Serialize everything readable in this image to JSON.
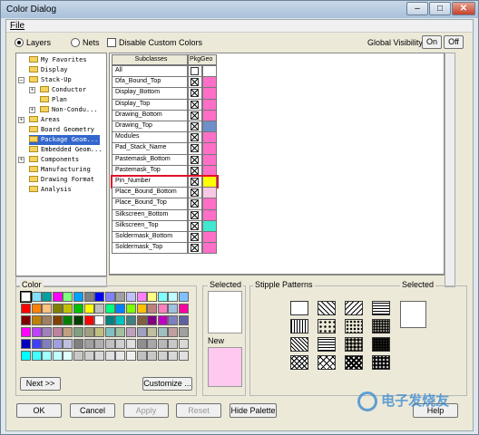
{
  "window": {
    "title": "Color Dialog",
    "controls": {
      "minimize": "–",
      "maximize": "□",
      "close": "✕"
    }
  },
  "menubar": {
    "file": "File"
  },
  "filters": {
    "layers": "Layers",
    "nets": "Nets",
    "disable_custom_colors": "Disable Custom Colors",
    "selected": "layers"
  },
  "global_visibility": {
    "label": "Global Visibility:",
    "on": "On",
    "off": "Off"
  },
  "tree": {
    "items": [
      {
        "label": "My Favorites",
        "level": 0,
        "expander": ""
      },
      {
        "label": "Display",
        "level": 0,
        "expander": ""
      },
      {
        "label": "Stack-Up",
        "level": 0,
        "expander": "–"
      },
      {
        "label": "Conductor",
        "level": 1,
        "expander": "+"
      },
      {
        "label": "Plan",
        "level": 1,
        "expander": ""
      },
      {
        "label": "Non-Condu...",
        "level": 1,
        "expander": "+"
      },
      {
        "label": "Areas",
        "level": 0,
        "expander": "+"
      },
      {
        "label": "Board Geometry",
        "level": 0,
        "expander": ""
      },
      {
        "label": "Package Geom...",
        "level": 0,
        "expander": "",
        "selected": true
      },
      {
        "label": "Embedded Geom...",
        "level": 0,
        "expander": ""
      },
      {
        "label": "Components",
        "level": 0,
        "expander": "+"
      },
      {
        "label": "Manufacturing",
        "level": 0,
        "expander": ""
      },
      {
        "label": "Drawing Format",
        "level": 0,
        "expander": ""
      },
      {
        "label": "Analysis",
        "level": 0,
        "expander": ""
      }
    ]
  },
  "grid": {
    "col_subclasses": "Subclasses",
    "col_pkggeo": "PkgGeo",
    "rows": [
      {
        "name": "All",
        "checked": false,
        "color": "#ffffff"
      },
      {
        "name": "Dfa_Bound_Top",
        "checked": true,
        "color": "#ff6ec7"
      },
      {
        "name": "Display_Bottom",
        "checked": true,
        "color": "#ff6ec7"
      },
      {
        "name": "Display_Top",
        "checked": true,
        "color": "#ff6ec7"
      },
      {
        "name": "Drawing_Bottom",
        "checked": true,
        "color": "#ff6ec7"
      },
      {
        "name": "Drawing_Top",
        "checked": true,
        "color": "#6e8fc8"
      },
      {
        "name": "Modules",
        "checked": true,
        "color": "#ff6ec7"
      },
      {
        "name": "Pad_Stack_Name",
        "checked": true,
        "color": "#ff6ec7"
      },
      {
        "name": "Pastemask_Bottom",
        "checked": true,
        "color": "#ff6ec7"
      },
      {
        "name": "Pastemask_Top",
        "checked": true,
        "color": "#ff6ec7"
      },
      {
        "name": "Pin_Number",
        "checked": true,
        "color": "#ffff00",
        "highlighted": true
      },
      {
        "name": "Place_Bound_Bottom",
        "checked": true,
        "color": "#f7c8e3"
      },
      {
        "name": "Place_Bound_Top",
        "checked": true,
        "color": "#ff6ec7"
      },
      {
        "name": "Silkscreen_Bottom",
        "checked": true,
        "color": "#ff6ec7"
      },
      {
        "name": "Silkscreen_Top",
        "checked": true,
        "color": "#40e8d0"
      },
      {
        "name": "Soldermask_Bottom",
        "checked": true,
        "color": "#ff6ec7"
      },
      {
        "name": "Soldermask_Top",
        "checked": true,
        "color": "#ff6ec7"
      }
    ]
  },
  "color_group": {
    "label": "Color",
    "palette": [
      [
        "#ffffff",
        "#7fdfff",
        "#00a0a0",
        "#ff00ff",
        "#80ff80",
        "#00a0ff",
        "#808080",
        "#0000ff",
        "#8080ff",
        "#a0a0a0",
        "#c0c0ff",
        "#ff80ff",
        "#ffff80",
        "#80ffff",
        "#c0ffff",
        "#80c0ff"
      ],
      [
        "#ff0000",
        "#ff8000",
        "#ffc080",
        "#808000",
        "#c0c000",
        "#00c000",
        "#ffff00",
        "#c0c0c0",
        "#00ff80",
        "#0080ff",
        "#80ff00",
        "#ffc000",
        "#c08080",
        "#ff80c0",
        "#a0c0e0",
        "#ff00a0"
      ],
      [
        "#800000",
        "#c08000",
        "#a08060",
        "#804000",
        "#008000",
        "#004000",
        "#ff0000",
        "#ffffff",
        "#008080",
        "#00c0c0",
        "#408080",
        "#806040",
        "#800080",
        "#c000c0",
        "#8080c0",
        "#6060a0"
      ],
      [
        "#ff00ff",
        "#c040ff",
        "#a080c0",
        "#c080a0",
        "#c0a080",
        "#80a080",
        "#a0a080",
        "#c0c080",
        "#80c0c0",
        "#a0c0a0",
        "#c0a0c0",
        "#a0a0c0",
        "#c0c0a0",
        "#a0c0c0",
        "#c0a0a0",
        "#a0a0a0"
      ],
      [
        "#0000c0",
        "#4040ff",
        "#8080c0",
        "#a0a0e0",
        "#c0c0e0",
        "#808080",
        "#a0a0a0",
        "#b0b0b0",
        "#c0c0c0",
        "#d0d0d0",
        "#e0e0e0",
        "#909090",
        "#a8a8a8",
        "#b8b8b8",
        "#c8c8c8",
        "#d8d8d8"
      ],
      [
        "#00ffff",
        "#40ffff",
        "#a0ffff",
        "#c0ffff",
        "#e0ffff",
        "#c8c8c8",
        "#d0d0d0",
        "#d8d8d8",
        "#e0e0e0",
        "#e8e8e8",
        "#f0f0f0",
        "#c0c0c0",
        "#c8c8c8",
        "#d0d0d0",
        "#d8d8d8",
        "#e0e0e0"
      ]
    ],
    "next_button": "Next >>",
    "customize_button": "Customize ..."
  },
  "selected_group": {
    "label": "Selected",
    "new_label": "New",
    "new_color": "#ffc8f0"
  },
  "stipple_group": {
    "label": "Stipple Patterns",
    "selected_label": "Selected"
  },
  "buttons": {
    "ok": "OK",
    "cancel": "Cancel",
    "apply": "Apply",
    "reset": "Reset",
    "hide_palette": "Hide Palette",
    "help": "Help"
  },
  "watermark": "电子发烧友"
}
